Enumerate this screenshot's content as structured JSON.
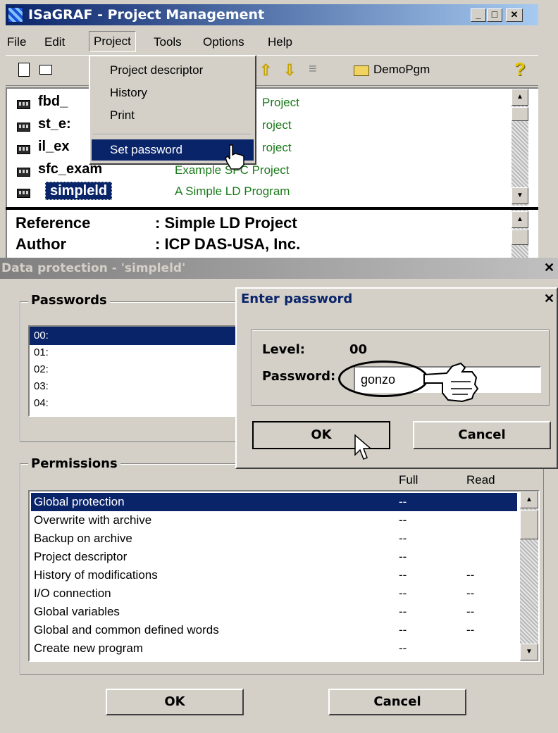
{
  "window": {
    "title": "ISaGRAF - Project Management",
    "min_label": "_",
    "max_label": "□",
    "close_label": "✕"
  },
  "menubar": [
    "File",
    "Edit",
    "Project",
    "Tools",
    "Options",
    "Help"
  ],
  "toolbar": {
    "folder_label": "DemoPgm"
  },
  "projects": [
    {
      "name": "fbd_",
      "description": "Project"
    },
    {
      "name": "st_e:",
      "description": "roject"
    },
    {
      "name": "il_ex",
      "description": "roject"
    },
    {
      "name": "sfc_exam",
      "description": "Example SFC Project"
    },
    {
      "name": "simpleld",
      "description": "A Simple LD Program"
    }
  ],
  "project_menu": {
    "items": [
      "Project descriptor",
      "History",
      "Print"
    ],
    "selected": "Set password"
  },
  "details": [
    {
      "label": "Reference",
      "value": ": Simple LD Project"
    },
    {
      "label": "Author",
      "value": ": ICP DAS-USA, Inc."
    }
  ],
  "data_protection": {
    "title": "Data protection - 'simpleld'",
    "close_label": "✕",
    "passwords_label": "Passwords",
    "password_levels": [
      "00:",
      "01:",
      "02:",
      "03:",
      "04:"
    ],
    "permissions_label": "Permissions",
    "col_full": "Full",
    "col_read": "Read",
    "permissions": [
      {
        "name": "Global protection",
        "full": "--",
        "read": ""
      },
      {
        "name": "Overwrite with archive",
        "full": "--",
        "read": ""
      },
      {
        "name": "Backup on archive",
        "full": "--",
        "read": ""
      },
      {
        "name": "Project descriptor",
        "full": "--",
        "read": ""
      },
      {
        "name": "History of modifications",
        "full": "--",
        "read": "--"
      },
      {
        "name": "I/O connection",
        "full": "--",
        "read": "--"
      },
      {
        "name": "Global variables",
        "full": "--",
        "read": "--"
      },
      {
        "name": "Global and common defined words",
        "full": "--",
        "read": "--"
      },
      {
        "name": "Create new program",
        "full": "--",
        "read": ""
      }
    ],
    "ok_label": "OK",
    "cancel_label": "Cancel"
  },
  "enter_password": {
    "title": "Enter password",
    "close_label": "✕",
    "level_label": "Level:",
    "level_value": "00",
    "password_label": "Password:",
    "password_value": "gonzo",
    "ok_label": "OK",
    "cancel_label": "Cancel"
  }
}
